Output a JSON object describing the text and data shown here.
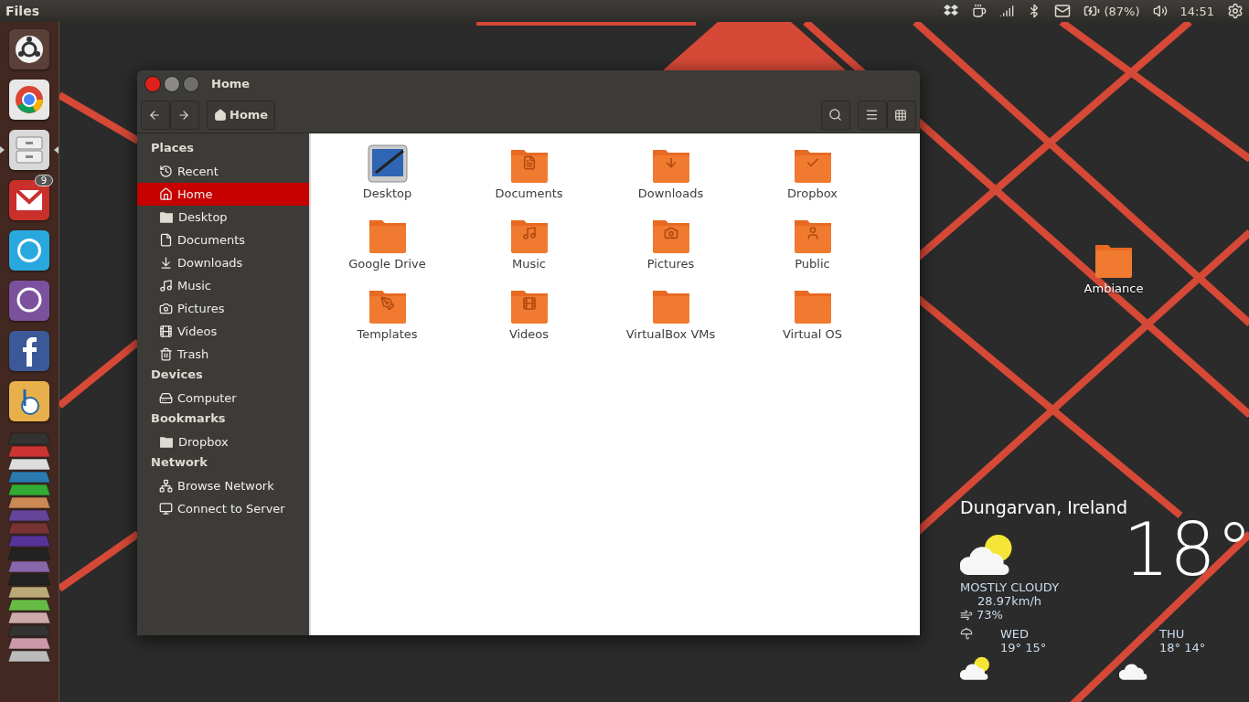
{
  "top_panel": {
    "app_title": "Files",
    "battery_reading": "(87%)",
    "time": "14:51"
  },
  "launcher": {
    "items": [
      {
        "kind": "dash",
        "color": "#5a4036",
        "running": false
      },
      {
        "kind": "chrome",
        "color": "#e8e8e8",
        "running": false
      },
      {
        "kind": "files",
        "color": "#d9d9d9",
        "running": true
      },
      {
        "kind": "gmail",
        "color": "#c9302c",
        "badge": "9",
        "running": false
      },
      {
        "kind": "skype",
        "color": "#29a8e0",
        "running": false
      },
      {
        "kind": "viber",
        "color": "#7b519d",
        "running": false
      },
      {
        "kind": "facebook",
        "color": "#3b5998",
        "running": false
      },
      {
        "kind": "b",
        "color": "#e8b04a",
        "running": false
      }
    ]
  },
  "window": {
    "title": "Home",
    "path": "Home",
    "sidebar": [
      {
        "heading": "Places",
        "items": [
          {
            "label": "Recent",
            "kind": "recent",
            "selected": false
          },
          {
            "label": "Home",
            "kind": "home",
            "selected": true
          },
          {
            "label": "Desktop",
            "kind": "folder",
            "selected": false
          },
          {
            "label": "Documents",
            "kind": "document",
            "selected": false
          },
          {
            "label": "Downloads",
            "kind": "download",
            "selected": false
          },
          {
            "label": "Music",
            "kind": "music",
            "selected": false
          },
          {
            "label": "Pictures",
            "kind": "camera",
            "selected": false
          },
          {
            "label": "Videos",
            "kind": "video",
            "selected": false
          },
          {
            "label": "Trash",
            "kind": "trash",
            "selected": false
          }
        ]
      },
      {
        "heading": "Devices",
        "items": [
          {
            "label": "Computer",
            "kind": "drive",
            "selected": false
          }
        ]
      },
      {
        "heading": "Bookmarks",
        "items": [
          {
            "label": "Dropbox",
            "kind": "folder",
            "selected": false
          }
        ]
      },
      {
        "heading": "Network",
        "items": [
          {
            "label": "Browse Network",
            "kind": "network",
            "selected": false
          },
          {
            "label": "Connect to Server",
            "kind": "server",
            "selected": false
          }
        ]
      }
    ],
    "files": [
      {
        "name": "Desktop",
        "kind": "desktop"
      },
      {
        "name": "Documents",
        "kind": "documents"
      },
      {
        "name": "Downloads",
        "kind": "downloads"
      },
      {
        "name": "Dropbox",
        "kind": "dropbox"
      },
      {
        "name": "Google Drive",
        "kind": "plain"
      },
      {
        "name": "Music",
        "kind": "music"
      },
      {
        "name": "Pictures",
        "kind": "pictures"
      },
      {
        "name": "Public",
        "kind": "public"
      },
      {
        "name": "Templates",
        "kind": "templates"
      },
      {
        "name": "Videos",
        "kind": "videos"
      },
      {
        "name": "VirtualBox VMs",
        "kind": "plain"
      },
      {
        "name": "Virtual OS",
        "kind": "plain"
      }
    ]
  },
  "desktop_icons": [
    {
      "name": "Ambiance"
    }
  ],
  "weather": {
    "location": "Dungarvan, Ireland",
    "temperature": "18°",
    "condition": "MOSTLY CLOUDY",
    "wind": "28.97km/h",
    "humidity": "73%",
    "forecast": [
      {
        "day": "WED",
        "temps": "19° 15°",
        "kind": "partly_sunny"
      },
      {
        "day": "THU",
        "temps": "18° 14°",
        "kind": "cloudy"
      }
    ]
  }
}
